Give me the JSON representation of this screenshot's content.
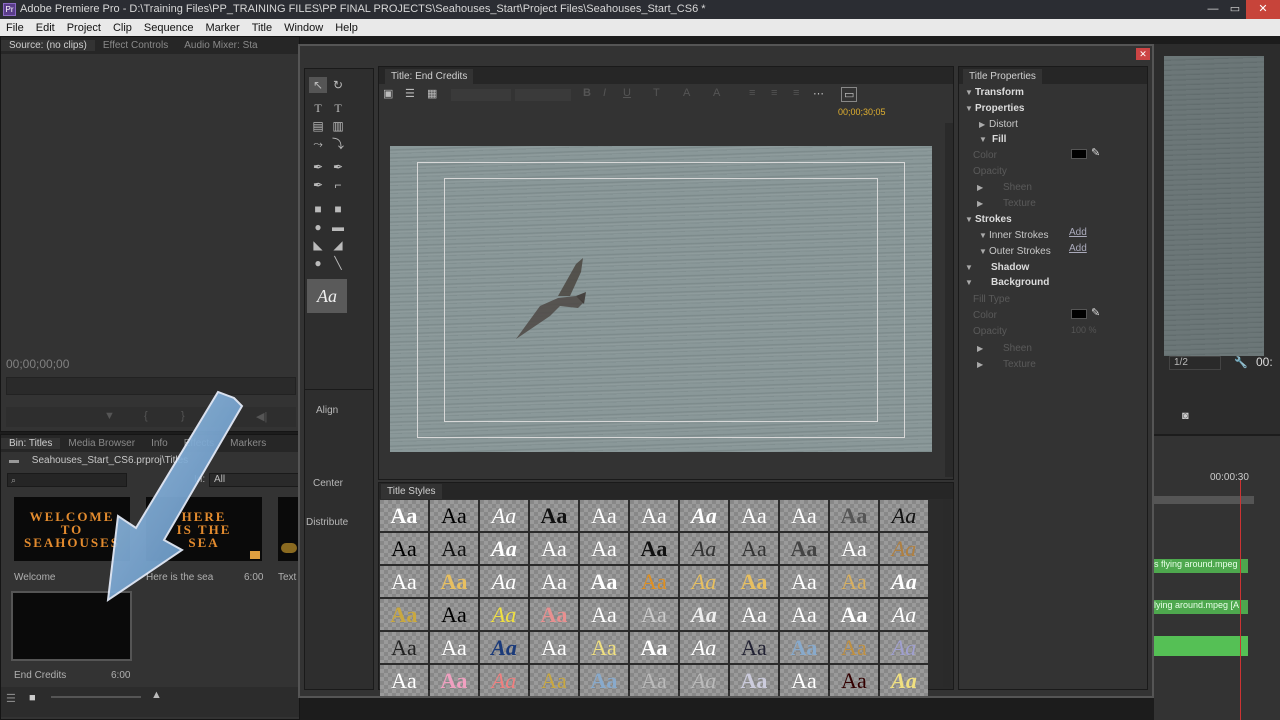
{
  "window": {
    "title": "Adobe Premiere Pro - D:\\Training Files\\PP_TRAINING FILES\\PP FINAL PROJECTS\\Seahouses_Start\\Project Files\\Seahouses_Start_CS6 *",
    "app_icon": "Pr",
    "controls": [
      "—",
      "▭",
      "✕"
    ]
  },
  "menu": [
    "File",
    "Edit",
    "Project",
    "Clip",
    "Sequence",
    "Marker",
    "Title",
    "Window",
    "Help"
  ],
  "source_panel": {
    "tabs": [
      "Source: (no clips)",
      "Effect Controls",
      "Audio Mixer: Sta"
    ],
    "timecode": "00;00;00;00"
  },
  "bin_panel": {
    "tabs": [
      "Bin: Titles",
      "Media Browser",
      "Info",
      "Effects",
      "Markers"
    ],
    "path": "Seahouses_Start_CS6.prproj\\Titles",
    "in_label": "In:",
    "in_value": "All",
    "items": [
      {
        "name": "Welcome",
        "thumb_text": "WELCOME\nTO\nSEAHOUSES",
        "duration": ""
      },
      {
        "name": "Here is the sea",
        "thumb_text": "HERE\nIS THE\nSEA",
        "duration": "6:00"
      },
      {
        "name": "Text",
        "thumb_text": "",
        "duration": ""
      },
      {
        "name": "End Credits",
        "thumb_text": "",
        "duration": "6:00"
      }
    ]
  },
  "title_designer": {
    "tab": "Title: End Credits",
    "timecode": "00;00;30;05",
    "align_label": "Align",
    "center_label": "Center",
    "distribute_label": "Distribute"
  },
  "title_styles": {
    "tab": "Title Styles",
    "sample": "Aa"
  },
  "title_properties": {
    "tab": "Title Properties",
    "rows": [
      {
        "label": "Transform",
        "bold": true
      },
      {
        "label": "Properties",
        "bold": true
      },
      {
        "label": "Distort",
        "bold": false
      },
      {
        "label": "Fill",
        "bold": true
      },
      {
        "label": "Color",
        "bold": false,
        "dim": true
      },
      {
        "label": "Opacity",
        "bold": false,
        "dim": true
      },
      {
        "label": "Sheen",
        "bold": false,
        "dim": true
      },
      {
        "label": "Texture",
        "bold": false,
        "dim": true
      },
      {
        "label": "Strokes",
        "bold": true
      },
      {
        "label": "Inner Strokes",
        "bold": false
      },
      {
        "label": "Outer Strokes",
        "bold": false
      },
      {
        "label": "Shadow",
        "bold": true
      },
      {
        "label": "Background",
        "bold": true
      },
      {
        "label": "Fill Type",
        "bold": false,
        "dim": true
      },
      {
        "label": "Color",
        "bold": false,
        "dim": true
      },
      {
        "label": "Opacity",
        "bold": false,
        "dim": true
      },
      {
        "label": "Sheen",
        "bold": false,
        "dim": true
      },
      {
        "label": "Texture",
        "bold": false,
        "dim": true
      }
    ],
    "add_label": "Add",
    "opacity_value": "100 %"
  },
  "program_monitor": {
    "zoom": "1/2",
    "timecode": "00:"
  },
  "timeline": {
    "time": "00:00:30",
    "clip1": "s flying around.mpeg",
    "clip2": "lying around.mpeg [A"
  }
}
